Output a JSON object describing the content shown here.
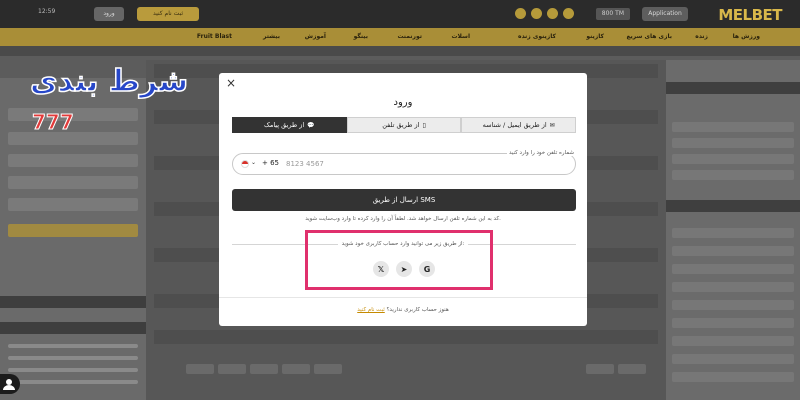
{
  "site": {
    "logo": "MELBET",
    "application_label": "Application",
    "balance_label": "800 TM",
    "time": "12:59",
    "register_label": "ثبت نام کنید",
    "login_label": "ورود",
    "nav_items": [
      "ورزش ها",
      "زنده",
      "بازی های سریع",
      "کازینو",
      "کازینوی زنده",
      "اسلات",
      "تورنمنت",
      "بینگو",
      "آموزش",
      "بیشتر",
      "Fruit Blast"
    ],
    "badge_text": "شرط بندی",
    "badge_number": "777"
  },
  "modal": {
    "close": "×",
    "title": "ورود",
    "tabs": [
      {
        "label": "از طریق ایمیل / شناسه",
        "icon": "✉",
        "active": false
      },
      {
        "label": "از طریق تلفن",
        "icon": "▯",
        "active": false
      },
      {
        "label": "از طریق پیامک",
        "icon": "💬",
        "active": true
      }
    ],
    "phone_label": "شماره تلفن خود را وارد کنید",
    "country_code": "+ 65",
    "phone_placeholder": "8123 4567",
    "sms_button": "ارسال از طریق SMS",
    "sms_note": "کد به این شماره تلفن ارسال خواهد شد. لطفاً آن را وارد کرده تا وارد وب‌سایت شوید.",
    "social_label": "از طریق زیر می توانید وارد حساب کاربری خود شوید:",
    "social": [
      "G",
      "➤",
      "𝕏"
    ],
    "footer_text": "هنوز حساب کاربری ندارید؟",
    "footer_link": "ثبت نام کنید"
  }
}
